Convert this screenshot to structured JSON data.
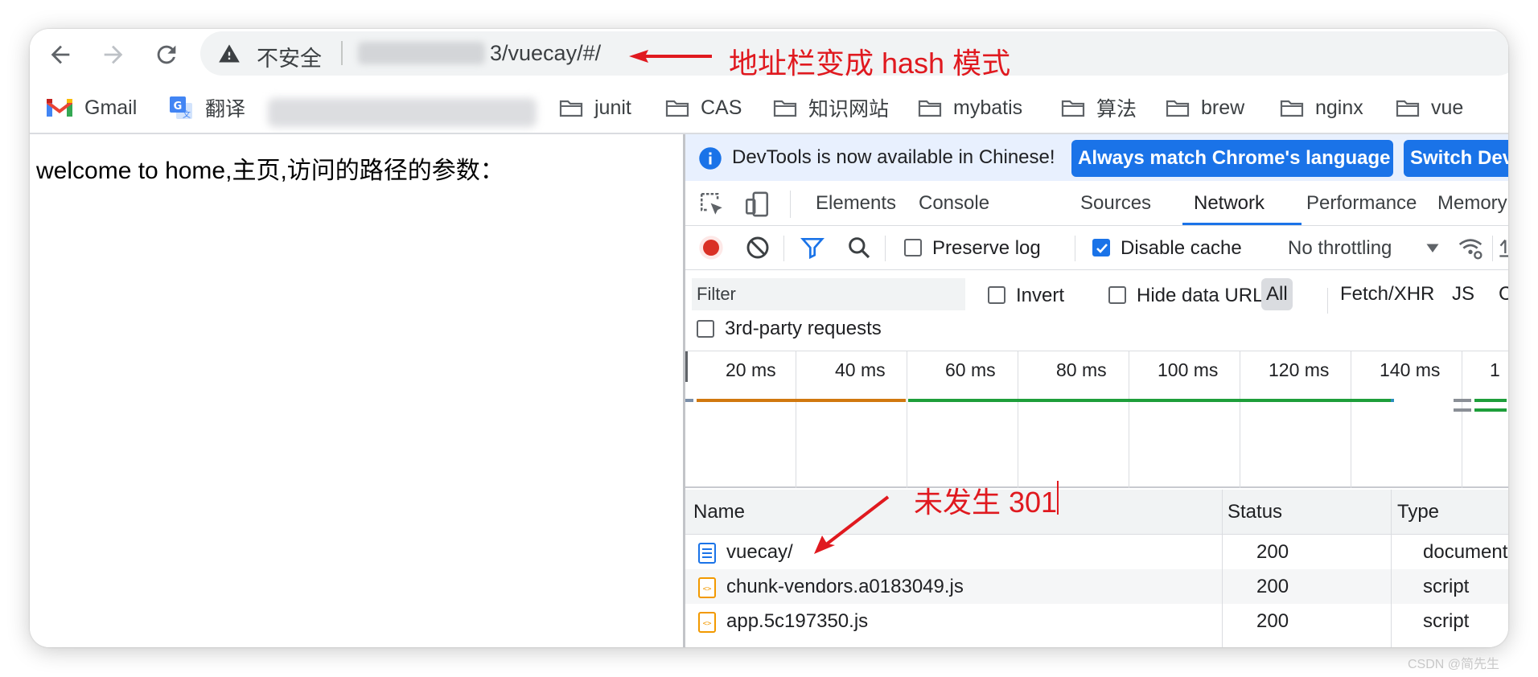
{
  "browser": {
    "omnibox": {
      "security_label": "不安全",
      "url_visible": "3/vuecay/#/"
    },
    "bookmarks": [
      {
        "label": "Gmail",
        "icon": "gmail-icon"
      },
      {
        "label": "翻译",
        "icon": "translate-icon"
      },
      {
        "label": "junit",
        "icon": "folder-icon"
      },
      {
        "label": "CAS",
        "icon": "folder-icon"
      },
      {
        "label": "知识网站",
        "icon": "folder-icon"
      },
      {
        "label": "mybatis",
        "icon": "folder-icon"
      },
      {
        "label": "算法",
        "icon": "folder-icon"
      },
      {
        "label": "brew",
        "icon": "folder-icon"
      },
      {
        "label": "nginx",
        "icon": "folder-icon"
      },
      {
        "label": "vue",
        "icon": "folder-icon"
      }
    ]
  },
  "page": {
    "text": "welcome to home,主页,访问的路径的参数："
  },
  "devtools": {
    "infobar": {
      "message": "DevTools is now available in Chinese!",
      "button_match": "Always match Chrome's language",
      "button_switch": "Switch Dev"
    },
    "tabs": [
      "Elements",
      "Console",
      "Sources",
      "Network",
      "Performance",
      "Memory"
    ],
    "active_tab": "Network",
    "toolbar": {
      "preserve_log": "Preserve log",
      "preserve_log_checked": false,
      "disable_cache": "Disable cache",
      "disable_cache_checked": true,
      "throttling": "No throttling"
    },
    "filter": {
      "placeholder": "Filter",
      "invert": "Invert",
      "hide_data_urls": "Hide data URLs",
      "types": [
        "All",
        "Fetch/XHR",
        "JS",
        "CSS"
      ],
      "third_party": "3rd-party requests"
    },
    "timeline": {
      "ticks": [
        "20 ms",
        "40 ms",
        "60 ms",
        "80 ms",
        "100 ms",
        "120 ms",
        "140 ms",
        "1"
      ]
    },
    "table": {
      "columns": [
        "Name",
        "Status",
        "Type"
      ],
      "rows": [
        {
          "name": "vuecay/",
          "status": "200",
          "type": "document",
          "icon": "document-icon"
        },
        {
          "name": "chunk-vendors.a0183049.js",
          "status": "200",
          "type": "script",
          "icon": "script-icon"
        },
        {
          "name": "app.5c197350.js",
          "status": "200",
          "type": "script",
          "icon": "script-icon"
        }
      ]
    }
  },
  "annotations": {
    "address_note": "地址栏变成 hash 模式",
    "redirect_note": "未发生 301"
  },
  "watermark": "CSDN @简先生",
  "colors": {
    "annotation_red": "#e0191f",
    "accent_blue": "#1a73e8",
    "record_red": "#d93025",
    "waterfall_orange": "#d1780f",
    "waterfall_green": "#1e9e3a"
  }
}
